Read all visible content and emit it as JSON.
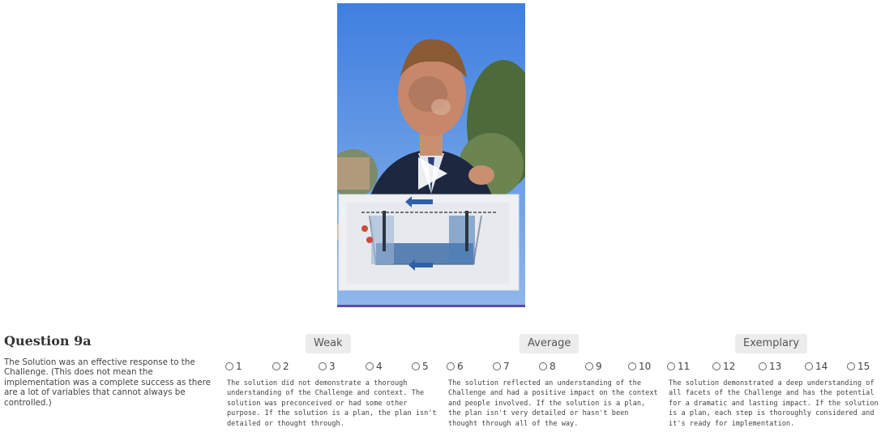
{
  "video": {
    "play_icon": "play-icon"
  },
  "question": {
    "title": "Question 9a",
    "description": "The Solution was an effective response to the Challenge. (This does not mean the implementation was a complete success as there are a lot of variables that cannot always be controlled.)"
  },
  "scale": {
    "groups": [
      {
        "label": "Weak",
        "options": [
          "1",
          "2",
          "3",
          "4",
          "5"
        ],
        "description": "The solution did not demonstrate a thorough understanding of the Challenge and context. The solution was preconceived or had some other purpose. If the solution is a plan, the plan isn't detailed or thought through."
      },
      {
        "label": "Average",
        "options": [
          "6",
          "7",
          "8",
          "9",
          "10"
        ],
        "description": "The solution reflected an understanding of the Challenge and had a positive impact on the context and people involved. If the solution is a plan, the plan isn't very detailed or hasn't been thought through all of the way."
      },
      {
        "label": "Exemplary",
        "options": [
          "11",
          "12",
          "13",
          "14",
          "15"
        ],
        "description": "The solution demonstrated a deep understanding of all facets of the Challenge and has the potential for a dramatic and lasting impact. If the solution is a plan, each step is thoroughly considered and it's ready for implementation."
      }
    ]
  }
}
